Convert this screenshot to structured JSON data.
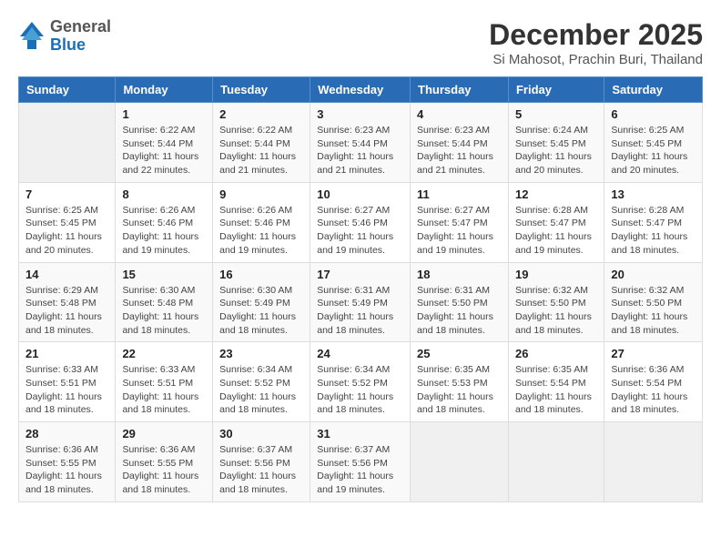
{
  "logo": {
    "general": "General",
    "blue": "Blue"
  },
  "title": "December 2025",
  "subtitle": "Si Mahosot, Prachin Buri, Thailand",
  "headers": [
    "Sunday",
    "Monday",
    "Tuesday",
    "Wednesday",
    "Thursday",
    "Friday",
    "Saturday"
  ],
  "weeks": [
    [
      {
        "day": "",
        "info": ""
      },
      {
        "day": "1",
        "info": "Sunrise: 6:22 AM\nSunset: 5:44 PM\nDaylight: 11 hours and 22 minutes."
      },
      {
        "day": "2",
        "info": "Sunrise: 6:22 AM\nSunset: 5:44 PM\nDaylight: 11 hours and 21 minutes."
      },
      {
        "day": "3",
        "info": "Sunrise: 6:23 AM\nSunset: 5:44 PM\nDaylight: 11 hours and 21 minutes."
      },
      {
        "day": "4",
        "info": "Sunrise: 6:23 AM\nSunset: 5:44 PM\nDaylight: 11 hours and 21 minutes."
      },
      {
        "day": "5",
        "info": "Sunrise: 6:24 AM\nSunset: 5:45 PM\nDaylight: 11 hours and 20 minutes."
      },
      {
        "day": "6",
        "info": "Sunrise: 6:25 AM\nSunset: 5:45 PM\nDaylight: 11 hours and 20 minutes."
      }
    ],
    [
      {
        "day": "7",
        "info": "Sunrise: 6:25 AM\nSunset: 5:45 PM\nDaylight: 11 hours and 20 minutes."
      },
      {
        "day": "8",
        "info": "Sunrise: 6:26 AM\nSunset: 5:46 PM\nDaylight: 11 hours and 19 minutes."
      },
      {
        "day": "9",
        "info": "Sunrise: 6:26 AM\nSunset: 5:46 PM\nDaylight: 11 hours and 19 minutes."
      },
      {
        "day": "10",
        "info": "Sunrise: 6:27 AM\nSunset: 5:46 PM\nDaylight: 11 hours and 19 minutes."
      },
      {
        "day": "11",
        "info": "Sunrise: 6:27 AM\nSunset: 5:47 PM\nDaylight: 11 hours and 19 minutes."
      },
      {
        "day": "12",
        "info": "Sunrise: 6:28 AM\nSunset: 5:47 PM\nDaylight: 11 hours and 19 minutes."
      },
      {
        "day": "13",
        "info": "Sunrise: 6:28 AM\nSunset: 5:47 PM\nDaylight: 11 hours and 18 minutes."
      }
    ],
    [
      {
        "day": "14",
        "info": "Sunrise: 6:29 AM\nSunset: 5:48 PM\nDaylight: 11 hours and 18 minutes."
      },
      {
        "day": "15",
        "info": "Sunrise: 6:30 AM\nSunset: 5:48 PM\nDaylight: 11 hours and 18 minutes."
      },
      {
        "day": "16",
        "info": "Sunrise: 6:30 AM\nSunset: 5:49 PM\nDaylight: 11 hours and 18 minutes."
      },
      {
        "day": "17",
        "info": "Sunrise: 6:31 AM\nSunset: 5:49 PM\nDaylight: 11 hours and 18 minutes."
      },
      {
        "day": "18",
        "info": "Sunrise: 6:31 AM\nSunset: 5:50 PM\nDaylight: 11 hours and 18 minutes."
      },
      {
        "day": "19",
        "info": "Sunrise: 6:32 AM\nSunset: 5:50 PM\nDaylight: 11 hours and 18 minutes."
      },
      {
        "day": "20",
        "info": "Sunrise: 6:32 AM\nSunset: 5:50 PM\nDaylight: 11 hours and 18 minutes."
      }
    ],
    [
      {
        "day": "21",
        "info": "Sunrise: 6:33 AM\nSunset: 5:51 PM\nDaylight: 11 hours and 18 minutes."
      },
      {
        "day": "22",
        "info": "Sunrise: 6:33 AM\nSunset: 5:51 PM\nDaylight: 11 hours and 18 minutes."
      },
      {
        "day": "23",
        "info": "Sunrise: 6:34 AM\nSunset: 5:52 PM\nDaylight: 11 hours and 18 minutes."
      },
      {
        "day": "24",
        "info": "Sunrise: 6:34 AM\nSunset: 5:52 PM\nDaylight: 11 hours and 18 minutes."
      },
      {
        "day": "25",
        "info": "Sunrise: 6:35 AM\nSunset: 5:53 PM\nDaylight: 11 hours and 18 minutes."
      },
      {
        "day": "26",
        "info": "Sunrise: 6:35 AM\nSunset: 5:54 PM\nDaylight: 11 hours and 18 minutes."
      },
      {
        "day": "27",
        "info": "Sunrise: 6:36 AM\nSunset: 5:54 PM\nDaylight: 11 hours and 18 minutes."
      }
    ],
    [
      {
        "day": "28",
        "info": "Sunrise: 6:36 AM\nSunset: 5:55 PM\nDaylight: 11 hours and 18 minutes."
      },
      {
        "day": "29",
        "info": "Sunrise: 6:36 AM\nSunset: 5:55 PM\nDaylight: 11 hours and 18 minutes."
      },
      {
        "day": "30",
        "info": "Sunrise: 6:37 AM\nSunset: 5:56 PM\nDaylight: 11 hours and 18 minutes."
      },
      {
        "day": "31",
        "info": "Sunrise: 6:37 AM\nSunset: 5:56 PM\nDaylight: 11 hours and 19 minutes."
      },
      {
        "day": "",
        "info": ""
      },
      {
        "day": "",
        "info": ""
      },
      {
        "day": "",
        "info": ""
      }
    ]
  ]
}
